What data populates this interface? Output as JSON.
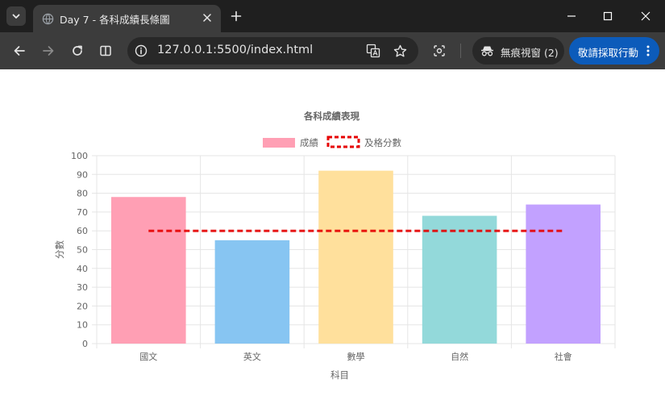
{
  "browser": {
    "tab_title": "Day 7 - 各科成績長條圖",
    "url": "127.0.0.1:5500/index.html",
    "incognito_label": "無痕視窗 (2)",
    "action_label": "敬請採取行動"
  },
  "chart_data": {
    "type": "bar",
    "title": "各科成績表現",
    "categories": [
      "國文",
      "英文",
      "數學",
      "自然",
      "社會"
    ],
    "series": [
      {
        "name": "成績",
        "type": "bar",
        "values": [
          78,
          55,
          92,
          68,
          74
        ],
        "colors": [
          "#ff9fb4",
          "#87c5f2",
          "#ffe09c",
          "#93d9da",
          "#c2a1ff"
        ]
      },
      {
        "name": "及格分數",
        "type": "line",
        "style": "dashed",
        "values": [
          60,
          60,
          60,
          60,
          60
        ],
        "color": "#e60000"
      }
    ],
    "xlabel": "科目",
    "ylabel": "分數",
    "ylim": [
      0,
      100
    ],
    "yticks": [
      "0",
      "10",
      "20",
      "30",
      "40",
      "50",
      "60",
      "70",
      "80",
      "90",
      "100"
    ],
    "grid": true,
    "legend_position": "top"
  }
}
